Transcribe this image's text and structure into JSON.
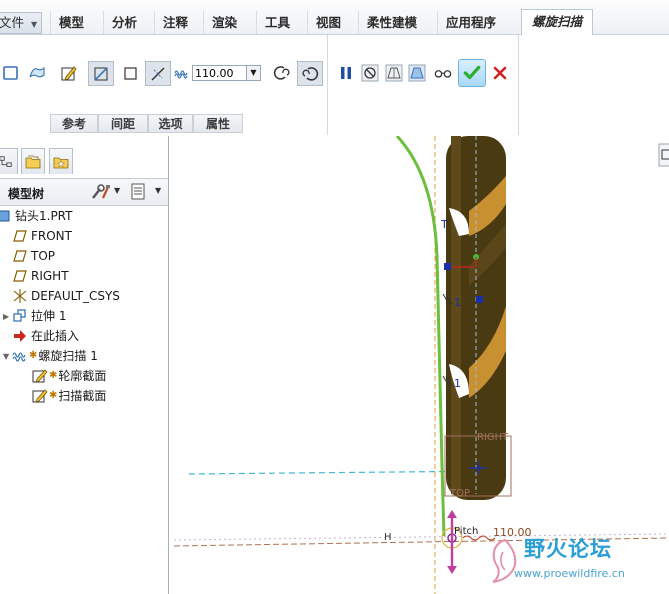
{
  "menubar": {
    "file_label": "文件",
    "tabs": [
      "模型",
      "分析",
      "注释",
      "渲染",
      "工具",
      "视图",
      "柔性建模",
      "应用程序"
    ],
    "active_tab": "螺旋扫描"
  },
  "ribbon": {
    "pitch_value": "110.00",
    "subtabs": [
      "参考",
      "间距",
      "选项",
      "属性"
    ]
  },
  "panel": {
    "tree_title": "模型树",
    "items": [
      {
        "label": "钻头1.PRT"
      },
      {
        "label": "FRONT"
      },
      {
        "label": "TOP"
      },
      {
        "label": "RIGHT"
      },
      {
        "label": "DEFAULT_CSYS"
      },
      {
        "label": "拉伸 1"
      },
      {
        "label": "在此插入"
      },
      {
        "label": "螺旋扫描 1"
      },
      {
        "label": "轮廓截面"
      },
      {
        "label": "扫描截面"
      }
    ]
  },
  "graphics": {
    "labels": {
      "t_label": "T",
      "dim1": "1",
      "dim2": "1",
      "right_label": "RIGHT",
      "top_label": "TOP",
      "h_label": "H",
      "pitch_label": "Pitch",
      "pitch_dim": "110.00"
    }
  },
  "watermark": {
    "text": "野火论坛",
    "url": "www.proewildfire.cn"
  },
  "colors": {
    "accent_blue": "#2a9ed6",
    "helix_green": "#6cbf3c",
    "drill_brown": "#4a3a12",
    "ok_green": "#2fae2f",
    "cancel_red": "#d42020"
  }
}
